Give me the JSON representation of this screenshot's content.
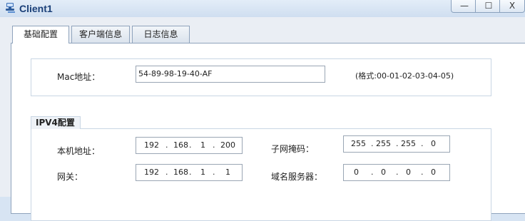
{
  "window": {
    "title": "Client1",
    "min_label": "—",
    "max_label": "☐",
    "close_label": "X"
  },
  "tabs": [
    {
      "label": "基础配置",
      "active": true
    },
    {
      "label": "客户端信息",
      "active": false
    },
    {
      "label": "日志信息",
      "active": false
    }
  ],
  "mac": {
    "label": "Mac地址：",
    "value": "54-89-98-19-40-AF",
    "hint": "(格式:00-01-02-03-04-05)"
  },
  "ipv4": {
    "section_label": "IPV4配置",
    "local_ip": {
      "label": "本机地址：",
      "octets": [
        "192",
        "168",
        "1",
        "200"
      ]
    },
    "subnet": {
      "label": "子网掩码：",
      "octets": [
        "255",
        "255",
        "255",
        "0"
      ]
    },
    "gateway": {
      "label": "网关：",
      "octets": [
        "192",
        "168",
        "1",
        "1"
      ]
    },
    "dns": {
      "label": "域名服务器：",
      "octets": [
        "0",
        "0",
        "0",
        "0"
      ]
    },
    "separator": "."
  }
}
